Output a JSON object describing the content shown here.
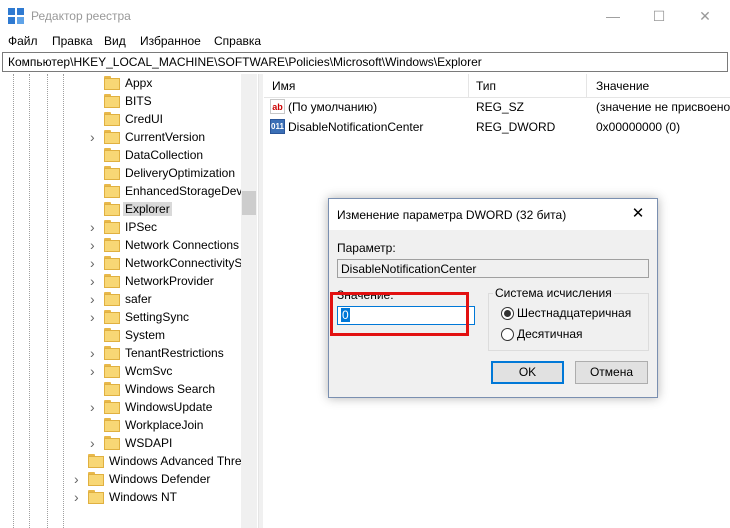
{
  "window": {
    "title": "Редактор реестра",
    "min_icon": "minimize-icon",
    "max_icon": "maximize-icon",
    "close_icon": "close-icon",
    "min_glyph": "—",
    "max_glyph": "☐",
    "close_glyph": "✕"
  },
  "menu": [
    "Файл",
    "Правка",
    "Вид",
    "Избранное",
    "Справка"
  ],
  "address": "Компьютер\\HKEY_LOCAL_MACHINE\\SOFTWARE\\Policies\\Microsoft\\Windows\\Explorer",
  "tree": {
    "items": [
      {
        "label": "Appx",
        "expandable": false
      },
      {
        "label": "BITS",
        "expandable": false
      },
      {
        "label": "CredUI",
        "expandable": false
      },
      {
        "label": "CurrentVersion",
        "expandable": true
      },
      {
        "label": "DataCollection",
        "expandable": false
      },
      {
        "label": "DeliveryOptimization",
        "expandable": false
      },
      {
        "label": "EnhancedStorageDevi",
        "expandable": false
      },
      {
        "label": "Explorer",
        "expandable": false,
        "selected": true
      },
      {
        "label": "IPSec",
        "expandable": true
      },
      {
        "label": "Network Connections",
        "expandable": true
      },
      {
        "label": "NetworkConnectivityS",
        "expandable": true
      },
      {
        "label": "NetworkProvider",
        "expandable": true
      },
      {
        "label": "safer",
        "expandable": true
      },
      {
        "label": "SettingSync",
        "expandable": true
      },
      {
        "label": "System",
        "expandable": false
      },
      {
        "label": "TenantRestrictions",
        "expandable": true
      },
      {
        "label": "WcmSvc",
        "expandable": true
      },
      {
        "label": "Windows Search",
        "expandable": false
      },
      {
        "label": "WindowsUpdate",
        "expandable": true
      },
      {
        "label": "WorkplaceJoin",
        "expandable": false
      },
      {
        "label": "WSDAPI",
        "expandable": true
      },
      {
        "label": "Windows Advanced Thre",
        "expandable": false,
        "level": 1
      },
      {
        "label": "Windows Defender",
        "expandable": true,
        "level": 1
      },
      {
        "label": "Windows NT",
        "expandable": true,
        "level": 1
      }
    ]
  },
  "list": {
    "headers": {
      "name": "Имя",
      "type": "Тип",
      "value": "Значение"
    },
    "rows": [
      {
        "icon": "string-value-icon",
        "icon_text": "ab",
        "name": "(По умолчанию)",
        "type": "REG_SZ",
        "value": "(значение не присвоено)"
      },
      {
        "icon": "dword-value-icon",
        "icon_text": "011",
        "name": "DisableNotificationCenter",
        "type": "REG_DWORD",
        "value": "0x00000000 (0)"
      }
    ]
  },
  "dialog": {
    "title": "Изменение параметра DWORD (32 бита)",
    "param_label": "Параметр:",
    "param_value": "DisableNotificationCenter",
    "value_label": "Значение:",
    "value_input": "0",
    "base_title": "Система исчисления",
    "radio_hex": "Шестнадцатеричная",
    "radio_dec": "Десятичная",
    "selected_base": "hex",
    "ok_label": "OK",
    "cancel_label": "Отмена",
    "close_glyph": "✕"
  },
  "colors": {
    "highlight": "#e21010",
    "accent": "#0078d7",
    "folder": "#f8d775"
  }
}
